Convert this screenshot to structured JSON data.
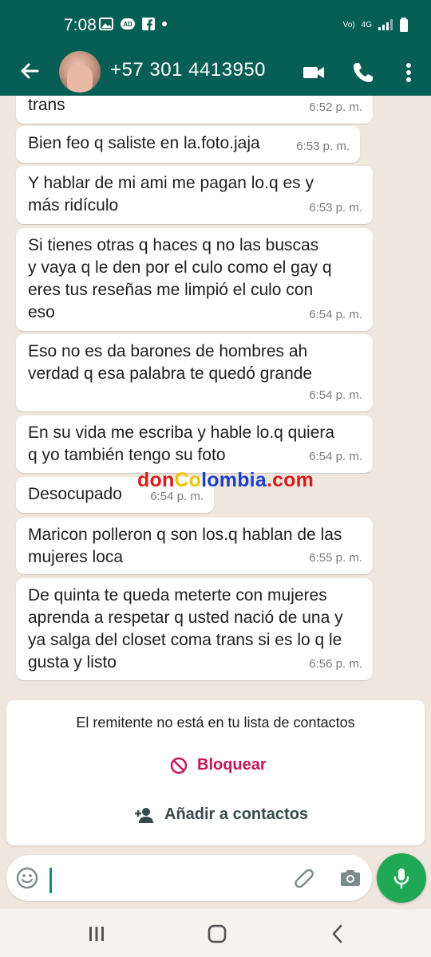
{
  "status_bar": {
    "time": "7:08",
    "signal_label": "4G",
    "volte_label": "Vo)",
    "network_label": "4G"
  },
  "chat_header": {
    "contact": "+57 301 4413950"
  },
  "messages": [
    {
      "text": "trans",
      "time": "6:52 p. m."
    },
    {
      "text": "Bien feo q saliste en la.foto.jaja",
      "time": "6:53 p. m."
    },
    {
      "text": "Y hablar de mi ami me pagan lo.q es y\nmás ridículo",
      "time": "6:53 p. m."
    },
    {
      "text": "Si tienes otras q haces q no las buscas\ny vaya q le den por el culo como el gay q\neres tus reseñas me limpió el culo con\neso",
      "time": "6:54 p. m."
    },
    {
      "text": "Eso no es da barones de hombres ah\nverdad q esa palabra te quedó grande",
      "time": "6:54 p. m."
    },
    {
      "text": "En su vida me escriba y hable lo.q quiera\nq yo también tengo su foto",
      "time": "6:54 p. m."
    },
    {
      "text": "Desocupado",
      "time": "6:54 p. m."
    },
    {
      "text": "Maricon polleron q son los.q hablan de las\nmujeres loca",
      "time": "6:55 p. m."
    },
    {
      "text": "De quinta te queda meterte con mujeres\naprenda a respetar q usted nació de una y\nya salga del closet coma trans si es lo q le\ngusta y listo",
      "time": "6:56 p. m."
    }
  ],
  "watermark": {
    "part1": "don",
    "part2": "Co",
    "part3": "lombia",
    "part4": ".com"
  },
  "unknown_contact": {
    "message": "El remitente no está en tu lista de contactos",
    "block_label": "Bloquear",
    "add_label": "Añadir a contactos"
  },
  "composer": {
    "value": ""
  },
  "colors": {
    "header": "#075e54",
    "accent": "#1fa855",
    "block": "#c2185b",
    "chat_bg": "#efe7de"
  }
}
